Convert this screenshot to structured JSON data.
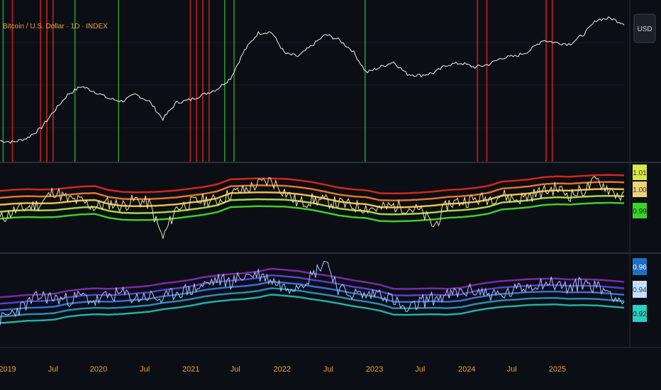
{
  "title": "Bitcoin / U.S. Dollar · 1D · INDEX",
  "currency_button": "USD",
  "colors": {
    "background": "#0b0e14",
    "title": "#e8a33a",
    "axis_text": "#e8a33a",
    "price_line": "#f2f2f2",
    "red_band": "#c0201c",
    "green_band": "#2fb53c",
    "separator": "#2a2e39"
  },
  "chart_data": [
    {
      "type": "line",
      "panel": "price",
      "series": [
        {
          "values": [
            0.06,
            0.05,
            0.08,
            0.15,
            0.28,
            0.4,
            0.46,
            0.42,
            0.37,
            0.35,
            0.4,
            0.35,
            0.22,
            0.34,
            0.36,
            0.4,
            0.44,
            0.52,
            0.72,
            0.85,
            0.86,
            0.7,
            0.68,
            0.76,
            0.84,
            0.8,
            0.72,
            0.56,
            0.6,
            0.64,
            0.55,
            0.54,
            0.56,
            0.62,
            0.63,
            0.6,
            0.62,
            0.67,
            0.68,
            0.72,
            0.8,
            0.78,
            0.77,
            0.84,
            0.95,
            0.96,
            0.92
          ]
        }
      ],
      "vertical_markers": {
        "red": [
          0.02,
          0.065,
          0.075,
          0.085,
          0.305,
          0.315,
          0.325,
          0.335,
          0.765,
          0.78,
          0.875,
          0.885
        ],
        "green": [
          0.005,
          0.12,
          0.19,
          0.36,
          0.375,
          0.585
        ]
      }
    },
    {
      "type": "line",
      "panel": "oscillator_1",
      "yticks": [
        "1.01",
        "1.00",
        "0.99"
      ],
      "band_colors": [
        "#d4261c",
        "#e8722a",
        "#e8c04a",
        "#a6d64a",
        "#3ccf2a"
      ],
      "series": [
        {
          "values": [
            0.35,
            0.45,
            0.5,
            0.55,
            0.72,
            0.6,
            0.58,
            0.5,
            0.56,
            0.52,
            0.6,
            0.55,
            0.1,
            0.5,
            0.55,
            0.6,
            0.58,
            0.68,
            0.72,
            0.8,
            0.85,
            0.7,
            0.55,
            0.6,
            0.58,
            0.55,
            0.52,
            0.5,
            0.48,
            0.52,
            0.5,
            0.45,
            0.25,
            0.55,
            0.58,
            0.6,
            0.62,
            0.66,
            0.6,
            0.65,
            0.7,
            0.75,
            0.66,
            0.72,
            0.85,
            0.72,
            0.62
          ]
        }
      ]
    },
    {
      "type": "line",
      "panel": "oscillator_2",
      "yticks": [
        "0.96",
        "0.94",
        "0.92"
      ],
      "band_colors": [
        "#7a2aa8",
        "#5a3fd0",
        "#3a6ed8",
        "#2a8ab8",
        "#1fb0a8"
      ],
      "series": [
        {
          "values": [
            0.25,
            0.35,
            0.45,
            0.55,
            0.52,
            0.5,
            0.55,
            0.48,
            0.55,
            0.58,
            0.52,
            0.55,
            0.5,
            0.6,
            0.62,
            0.68,
            0.75,
            0.72,
            0.8,
            0.82,
            0.75,
            0.65,
            0.7,
            0.8,
            1.0,
            0.62,
            0.58,
            0.55,
            0.6,
            0.5,
            0.35,
            0.48,
            0.52,
            0.55,
            0.6,
            0.62,
            0.58,
            0.55,
            0.62,
            0.68,
            0.72,
            0.7,
            0.64,
            0.72,
            0.66,
            0.6,
            0.45
          ]
        }
      ]
    }
  ],
  "xaxis": {
    "labels": [
      "2019",
      "Jul",
      "2020",
      "Jul",
      "2021",
      "Jul",
      "2022",
      "Jul",
      "2023",
      "Jul",
      "2024",
      "Jul",
      "2025"
    ],
    "positions": [
      0.012,
      0.085,
      0.158,
      0.232,
      0.306,
      0.377,
      0.452,
      0.526,
      0.6,
      0.673,
      0.748,
      0.82,
      0.893
    ]
  }
}
